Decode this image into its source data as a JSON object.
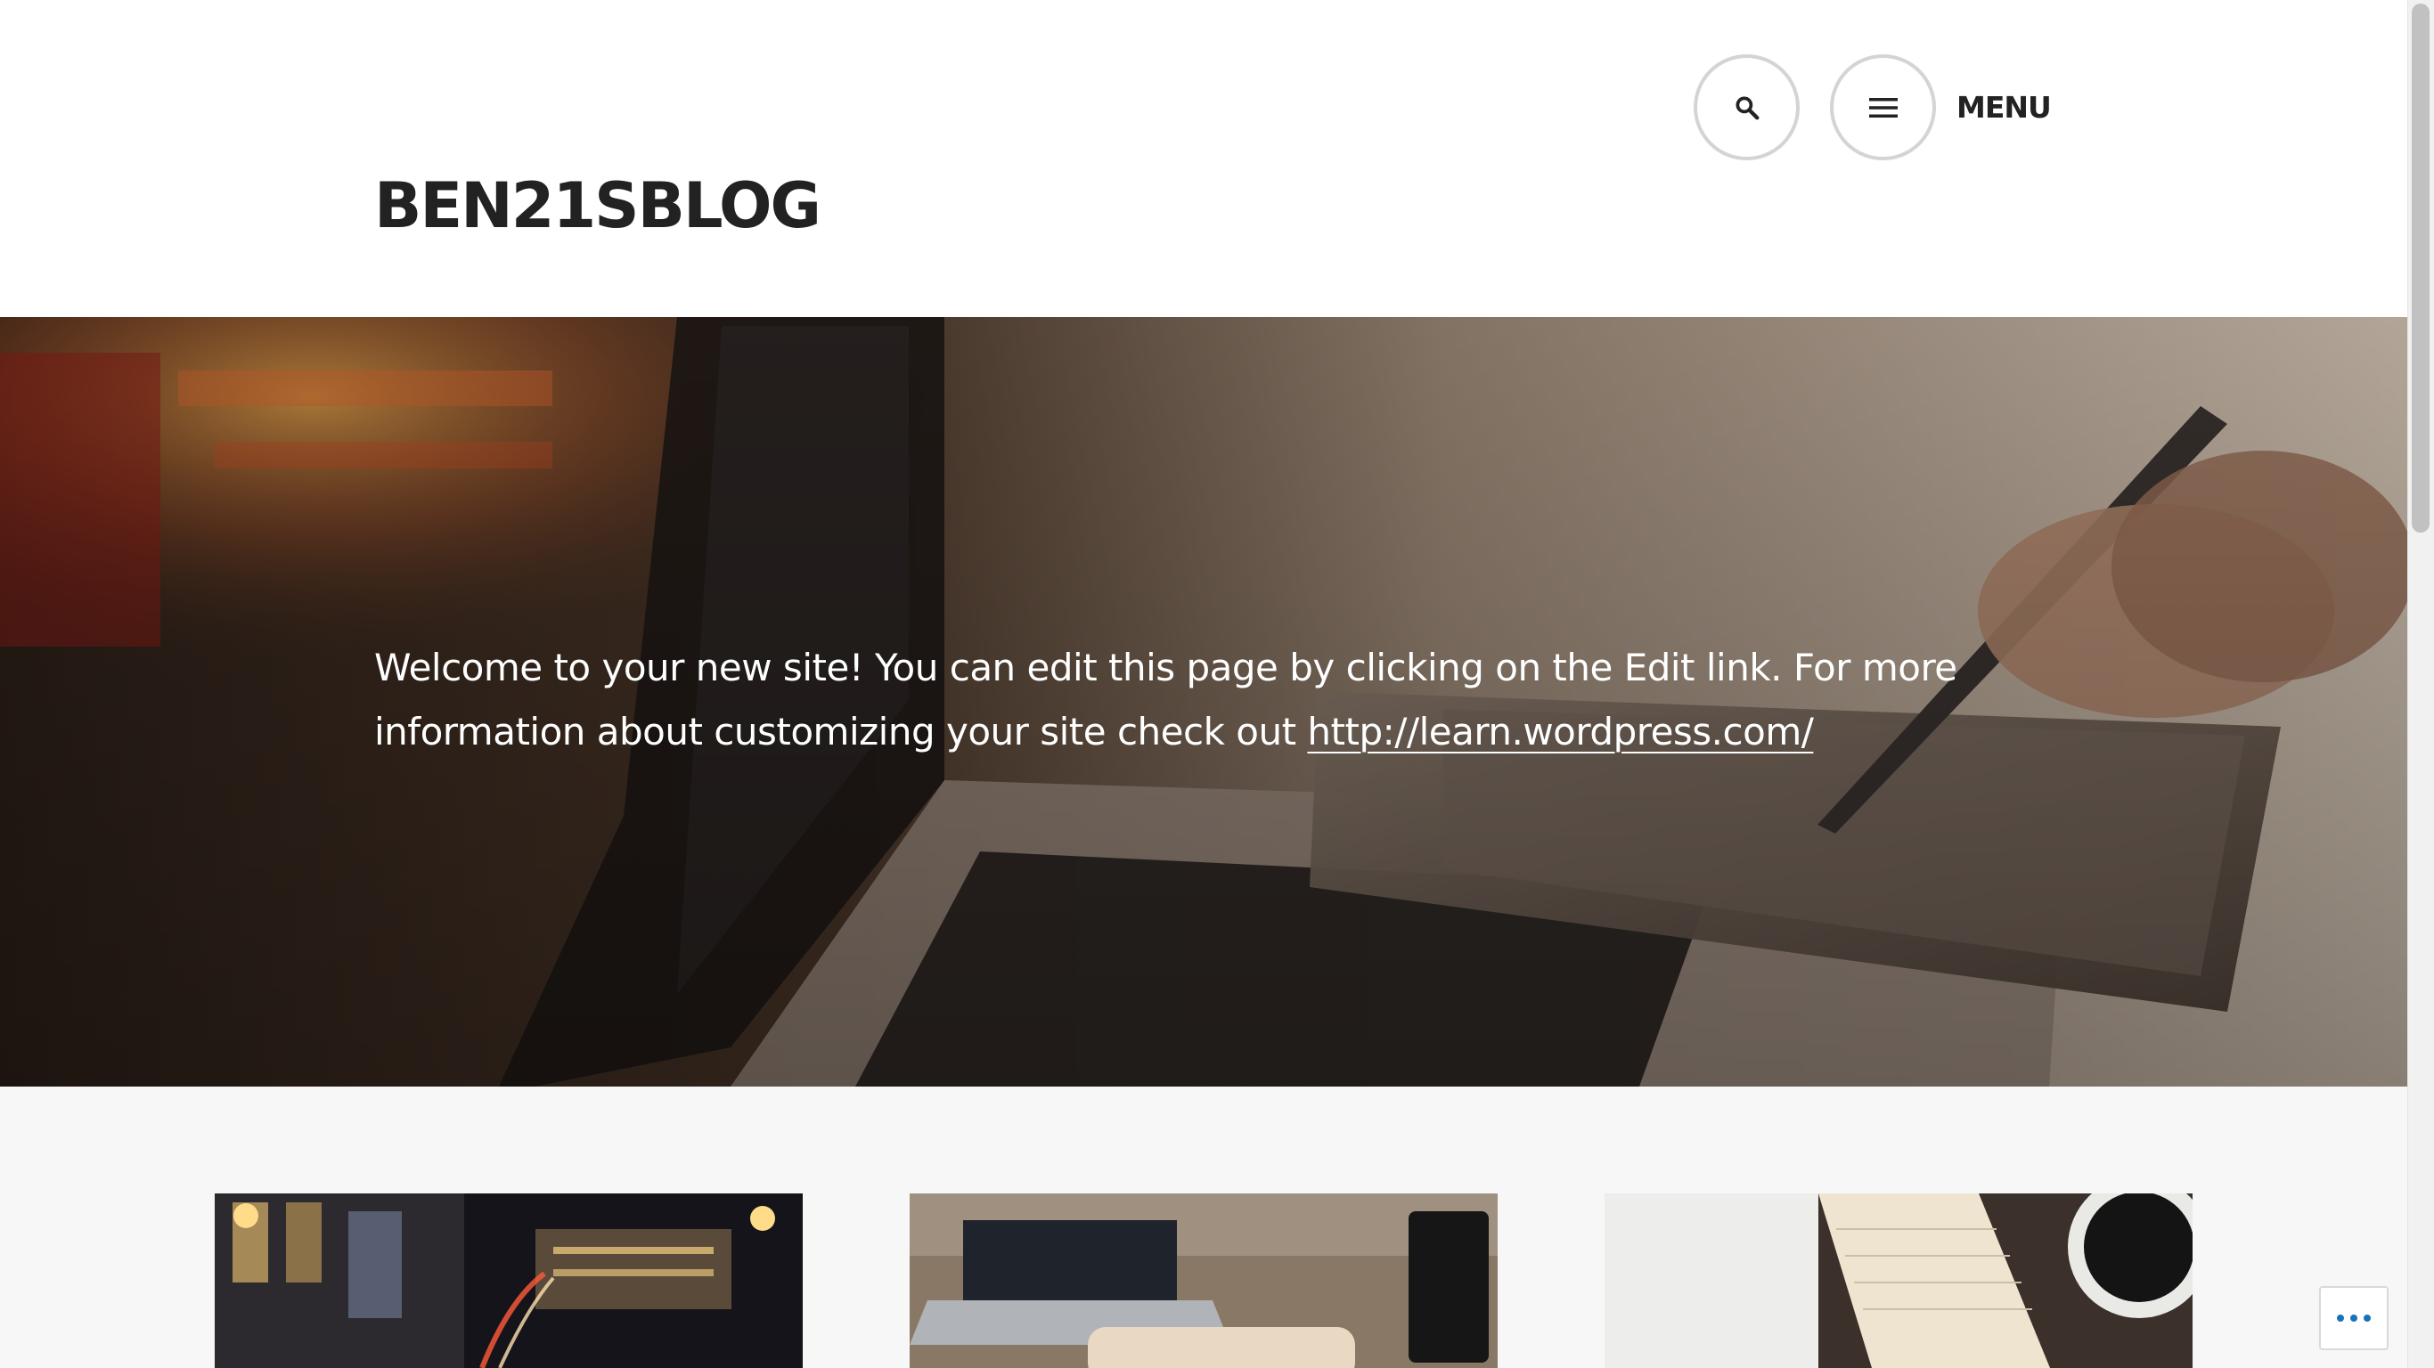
{
  "header": {
    "site_title": "BEN21SBLOG",
    "search_icon": "search-icon",
    "menu_icon": "hamburger-menu-icon",
    "menu_label": "MENU"
  },
  "hero": {
    "text_before_link": "Welcome to your new site! You can edit this page by clicking on the Edit link. For more information about customizing your site check out ",
    "link_text": "http://learn.wordpress.com/",
    "image": "laptop-and-drawing-tablet-photo"
  },
  "posts": [
    {
      "image": "city-street-night-photo"
    },
    {
      "image": "laptop-coffee-mug-photo"
    },
    {
      "image": "notebook-coffee-cup-photo"
    }
  ],
  "floating_button": {
    "icon": "more-options-icon"
  },
  "colors": {
    "title_text": "#222222",
    "header_bg": "#ffffff",
    "page_bg": "#f7f7f7",
    "button_border": "#d4d4d4"
  }
}
